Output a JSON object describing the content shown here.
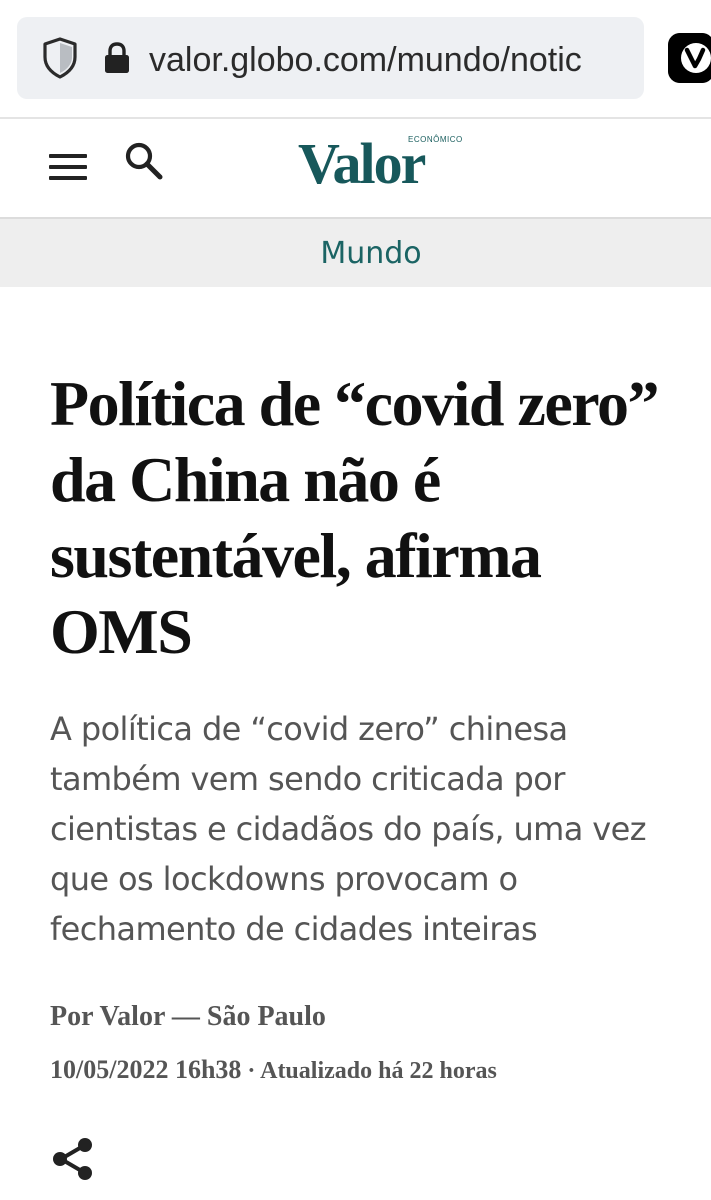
{
  "browser": {
    "url": "valor.globo.com/mundo/notic",
    "icons": [
      "shield-icon",
      "lock-icon",
      "vivaldi-icon"
    ]
  },
  "header": {
    "logo_text": "Valor",
    "logo_super": "ECONÔMICO",
    "icons": [
      "menu-icon",
      "search-icon"
    ]
  },
  "section": {
    "label": "Mundo"
  },
  "article": {
    "headline": "Política de “covid zero” da China não é sustentável, afirma OMS",
    "subtitle": "A política de “covid zero” chinesa também vem sendo criticada por cientistas e cidadãos do país, uma vez que os lockdowns provocam o fechamento de cidades inteiras",
    "byline": "Por Valor — São Paulo",
    "date": "10/05/2022 16h38",
    "separator": " · ",
    "updated": "Atualizado há 22 horas",
    "share_icon": "share-icon"
  },
  "colors": {
    "brand": "#17585b",
    "section_text": "#1b6464",
    "headline": "#111111",
    "body_text": "#555555",
    "url_pill": "#eef0f3",
    "section_bg": "#eeeeee"
  }
}
